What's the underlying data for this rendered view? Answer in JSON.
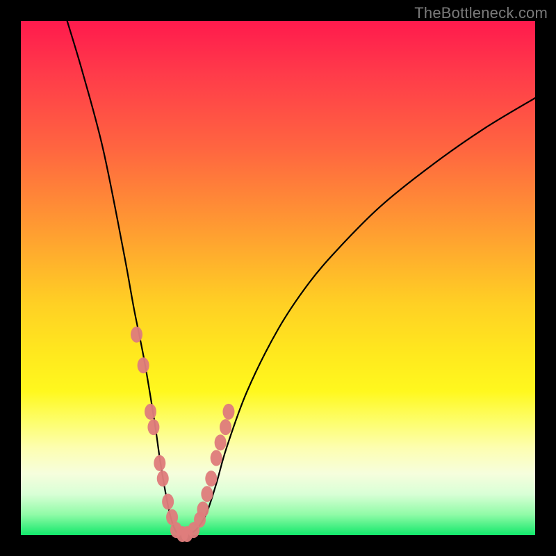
{
  "watermark": {
    "text": "TheBottleneck.com"
  },
  "chart_data": {
    "type": "line",
    "title": "",
    "xlabel": "",
    "ylabel": "",
    "xlim": [
      0,
      100
    ],
    "ylim": [
      0,
      100
    ],
    "series": [
      {
        "name": "bottleneck-curve",
        "x": [
          9,
          12,
          16,
          20,
          22,
          24,
          26,
          27,
          28,
          29,
          30,
          31,
          32,
          34,
          36,
          38,
          40,
          44,
          50,
          56,
          62,
          70,
          80,
          90,
          100
        ],
        "y": [
          100,
          90,
          75,
          55,
          44,
          34,
          22,
          15,
          9,
          4,
          1,
          0,
          0,
          1,
          4,
          10,
          17,
          28,
          40,
          49,
          56,
          64,
          72,
          79,
          85
        ]
      }
    ],
    "scatter_overlay": {
      "name": "highlighted-points",
      "color": "#df7d7c",
      "x": [
        22.5,
        23.8,
        25.2,
        25.8,
        27.0,
        27.6,
        28.6,
        29.4,
        30.2,
        31.4,
        32.3,
        33.6,
        34.8,
        35.4,
        36.2,
        37.0,
        38.0,
        38.8,
        39.8,
        40.4
      ],
      "y": [
        39.0,
        33.0,
        24.0,
        21.0,
        14.0,
        11.0,
        6.5,
        3.5,
        1.0,
        0.2,
        0.2,
        1.0,
        3.0,
        5.0,
        8.0,
        11.0,
        15.0,
        18.0,
        21.0,
        24.0
      ]
    }
  }
}
